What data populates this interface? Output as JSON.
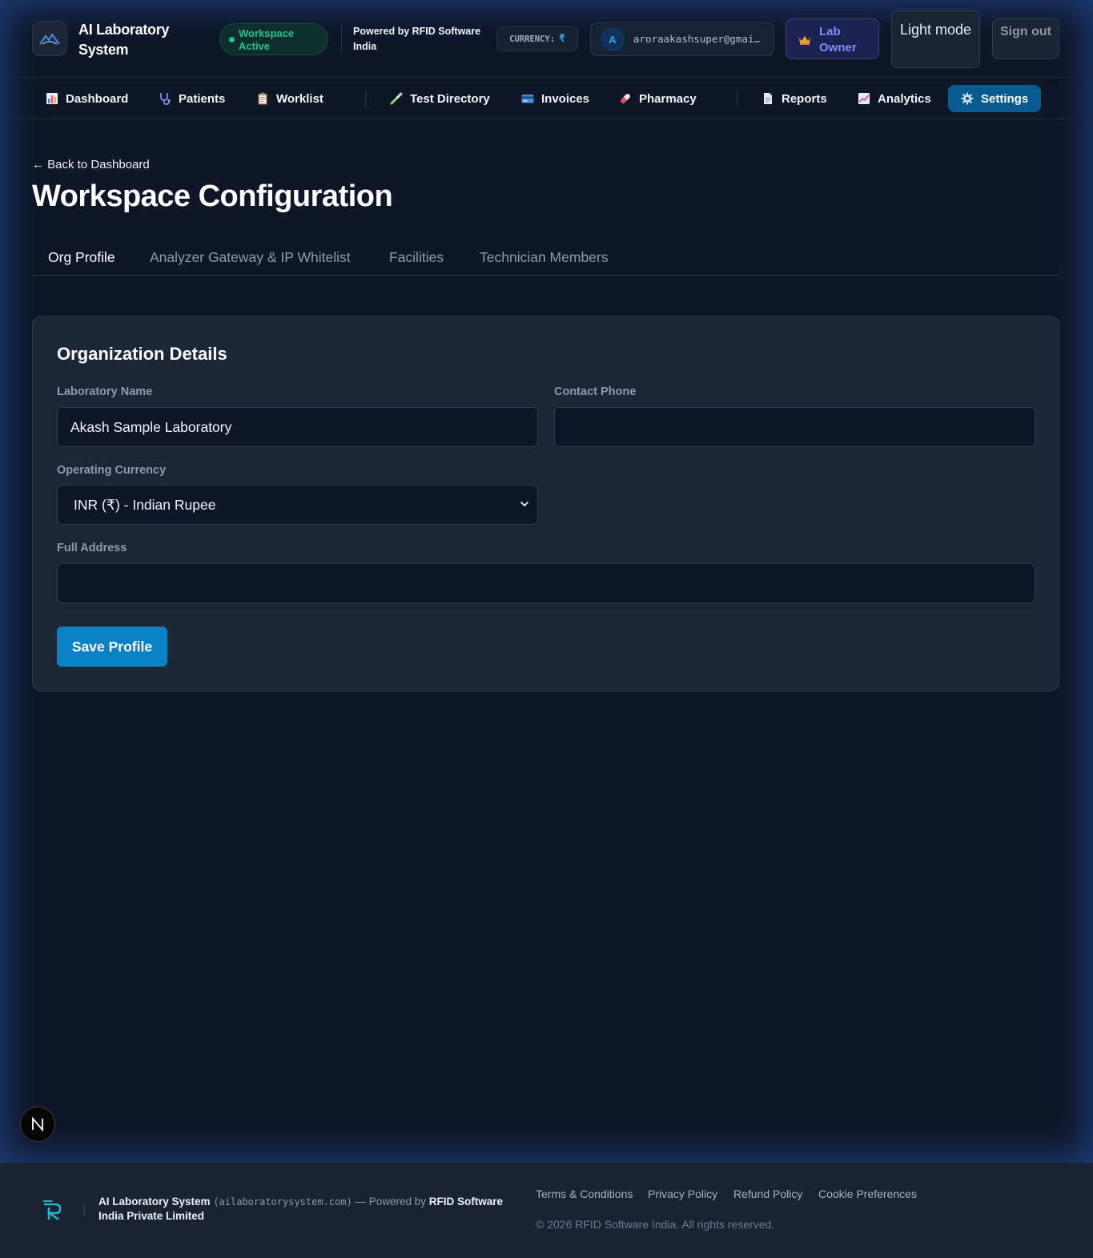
{
  "header": {
    "app_title": "AI Laboratory System",
    "workspace_status": "Workspace Active",
    "powered_by": "Powered by RFID Software India",
    "currency_label": "CURRENCY:",
    "currency_symbol": "₹",
    "user_initial": "A",
    "user_email": "aroraakashsuper@gmail.com",
    "role": "Lab Owner",
    "theme_toggle": "Light mode",
    "sign_out": "Sign out"
  },
  "nav": {
    "items": [
      {
        "label": "Dashboard",
        "icon": "bar-chart-icon"
      },
      {
        "label": "Patients",
        "icon": "stethoscope-icon"
      },
      {
        "label": "Worklist",
        "icon": "clipboard-icon"
      },
      {
        "label": "Test Directory",
        "icon": "pipette-icon"
      },
      {
        "label": "Invoices",
        "icon": "credit-card-icon"
      },
      {
        "label": "Pharmacy",
        "icon": "pill-icon"
      },
      {
        "label": "Reports",
        "icon": "document-icon"
      },
      {
        "label": "Analytics",
        "icon": "trend-chart-icon"
      },
      {
        "label": "Settings",
        "icon": "gear-icon"
      }
    ],
    "active": "Settings"
  },
  "page": {
    "back_link": "← Back to Dashboard",
    "title": "Workspace Configuration",
    "tabs": [
      "Org Profile",
      "Analyzer Gateway & IP Whitelist",
      "Facilities",
      "Technician Members"
    ],
    "active_tab": "Org Profile"
  },
  "form": {
    "section_title": "Organization Details",
    "lab_name_label": "Laboratory Name",
    "lab_name_value": "Akash Sample Laboratory",
    "phone_label": "Contact Phone",
    "phone_value": "",
    "currency_label": "Operating Currency",
    "currency_value": "INR (₹) - Indian Rupee",
    "address_label": "Full Address",
    "address_value": "",
    "save_button": "Save Profile"
  },
  "badge": {
    "letter": "N"
  },
  "footer": {
    "brand": "AI Laboratory System",
    "domain": "(ailaboratorysystem.com)",
    "powered_prefix": "— Powered by",
    "company": "RFID Software India Private Limited",
    "links": [
      "Terms & Conditions",
      "Privacy Policy",
      "Refund Policy",
      "Cookie Preferences"
    ],
    "copyright": "© 2026 RFID Software India. All rights reserved."
  },
  "colors": {
    "accent": "#0a81c7",
    "active_nav": "#0a5a92",
    "status_green": "#22c38e",
    "role_purple": "#7f8cf6",
    "page_bg": "#0e1627",
    "card_bg": "#1b2637"
  }
}
